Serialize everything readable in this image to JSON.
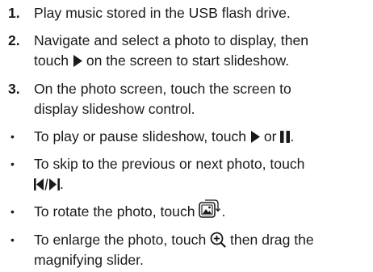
{
  "numbered": [
    {
      "num": "1.",
      "text": "Play music stored in the USB flash drive."
    },
    {
      "num": "2.",
      "text_a": "Navigate and select a photo to display, then",
      "text_b": "touch",
      "text_c": "on the screen to start slideshow."
    },
    {
      "num": "3.",
      "text_a": "On the photo screen, touch the screen to",
      "text_b": "display slideshow control."
    }
  ],
  "bullets": [
    {
      "mark": "•",
      "text_a": "To play or pause slideshow, touch",
      "text_b": "or",
      "text_c": "."
    },
    {
      "mark": "•",
      "text_a": "To skip to the previous or next photo, touch",
      "text_b": "."
    },
    {
      "mark": "•",
      "text_a": "To rotate the photo, touch",
      "text_b": "."
    },
    {
      "mark": "•",
      "text_a": "To enlarge the photo, touch",
      "text_b": "then drag the",
      "text_c": "magnifying slider."
    }
  ],
  "icons": {
    "play": "play-icon",
    "pause": "pause-icon",
    "prev_next": "previous-next-icon",
    "rotate": "rotate-photo-icon",
    "zoom": "zoom-in-icon"
  },
  "colors": {
    "text": "#1a1a1a",
    "background": "#ffffff"
  }
}
